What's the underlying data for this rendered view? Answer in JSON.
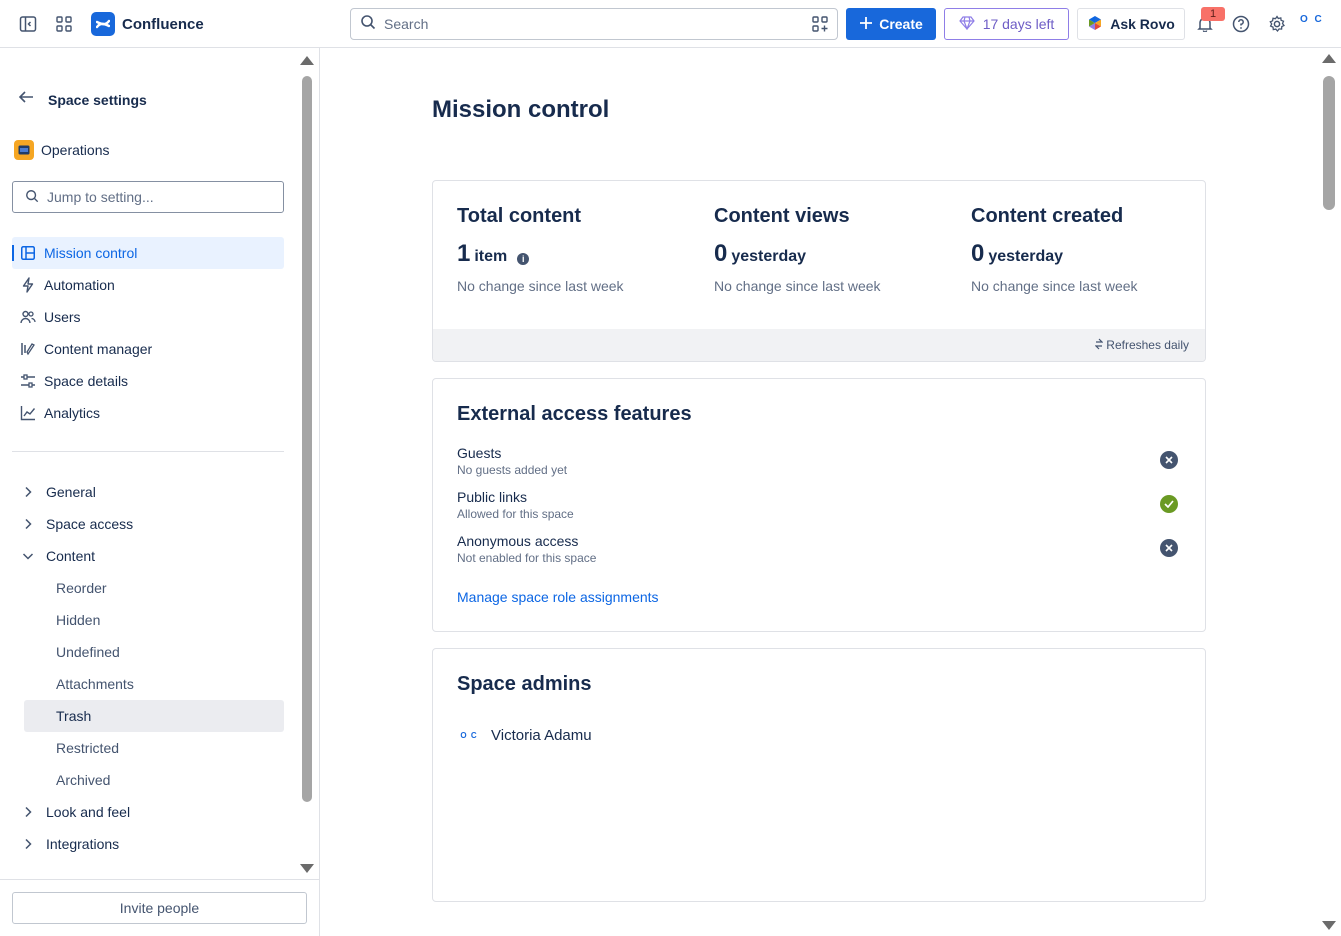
{
  "topbar": {
    "app_name": "Confluence",
    "search_placeholder": "Search",
    "create_label": "Create",
    "trial_label": "17 days left",
    "rovo_label": "Ask Rovo",
    "notification_count": "1",
    "avatar_initials": "O C"
  },
  "sidebar": {
    "back_title": "Space settings",
    "space_name": "Operations",
    "jump_placeholder": "Jump to setting...",
    "nav": [
      {
        "label": "Mission control",
        "icon": "layout-icon",
        "active": true
      },
      {
        "label": "Automation",
        "icon": "lightning-icon"
      },
      {
        "label": "Users",
        "icon": "users-icon"
      },
      {
        "label": "Content manager",
        "icon": "content-manager-icon"
      },
      {
        "label": "Space details",
        "icon": "sliders-icon"
      },
      {
        "label": "Analytics",
        "icon": "chart-icon"
      }
    ],
    "tree": [
      {
        "label": "General",
        "expanded": false
      },
      {
        "label": "Space access",
        "expanded": false
      },
      {
        "label": "Content",
        "expanded": true
      },
      {
        "label": "Look and feel",
        "expanded": false
      },
      {
        "label": "Integrations",
        "expanded": false
      }
    ],
    "content_children": [
      "Reorder",
      "Hidden",
      "Undefined",
      "Attachments",
      "Trash",
      "Restricted",
      "Archived"
    ],
    "selected_child": "Trash",
    "invite_label": "Invite people"
  },
  "main": {
    "title": "Mission control",
    "stats": [
      {
        "heading": "Total content",
        "number": "1",
        "unit": "item",
        "change": "No change since last week"
      },
      {
        "heading": "Content views",
        "number": "0",
        "unit": "yesterday",
        "change": "No change since last week"
      },
      {
        "heading": "Content created",
        "number": "0",
        "unit": "yesterday",
        "change": "No change since last week"
      }
    ],
    "refresh_note": "Refreshes daily",
    "external": {
      "heading": "External access features",
      "features": [
        {
          "name": "Guests",
          "desc": "No guests added yet",
          "enabled": false
        },
        {
          "name": "Public links",
          "desc": "Allowed for this space",
          "enabled": true
        },
        {
          "name": "Anonymous access",
          "desc": "Not enabled for this space",
          "enabled": false
        }
      ],
      "manage_link": "Manage space role assignments"
    },
    "admins": {
      "heading": "Space admins",
      "list": [
        {
          "name": "Victoria Adamu",
          "initials": "O C"
        }
      ]
    }
  },
  "colors": {
    "brand": "#1868db",
    "accent_purple": "#6e5dc6",
    "success": "#6a9a23",
    "link": "#0c66e4"
  }
}
